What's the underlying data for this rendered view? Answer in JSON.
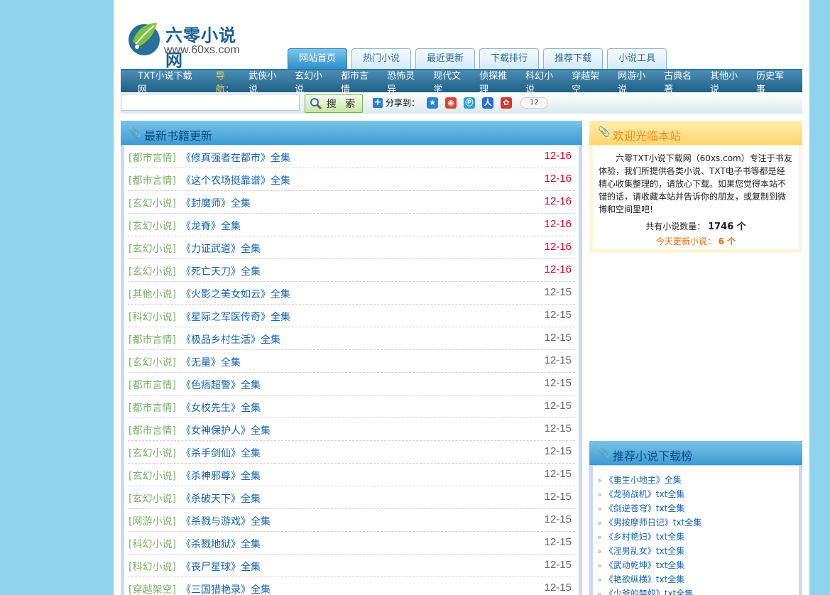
{
  "logo": {
    "cn": "六零小说网",
    "url": "www.60xs.com"
  },
  "tabs": [
    {
      "label": "网站首页",
      "active": true
    },
    {
      "label": "热门小说"
    },
    {
      "label": "最近更新"
    },
    {
      "label": "下载排行"
    },
    {
      "label": "推荐下载"
    },
    {
      "label": "小说工具"
    }
  ],
  "nav": {
    "brand": "TXT小说下载网",
    "label": "导航：",
    "items": [
      "武侠小说",
      "玄幻小说",
      "都市言情",
      "恐怖灵异",
      "现代文学",
      "侦探推理",
      "科幻小说",
      "穿越架空",
      "网游小说",
      "古典名著",
      "其他小说",
      "历史军事"
    ]
  },
  "search": {
    "button_label": "搜 索",
    "share_label": "分享到：",
    "share_count": "12"
  },
  "latest": {
    "title": "最新书籍更新",
    "rows": [
      {
        "cat": "[都市言情]",
        "title": "《修真强者在都市》全集",
        "date": "12-16",
        "today": true
      },
      {
        "cat": "[都市言情]",
        "title": "《这个农场挺靠谱》全集",
        "date": "12-16",
        "today": true
      },
      {
        "cat": "[玄幻小说]",
        "title": "《封魔师》全集",
        "date": "12-16",
        "today": true
      },
      {
        "cat": "[玄幻小说]",
        "title": "《龙脊》全集",
        "date": "12-16",
        "today": true
      },
      {
        "cat": "[玄幻小说]",
        "title": "《力证武道》全集",
        "date": "12-16",
        "today": true
      },
      {
        "cat": "[玄幻小说]",
        "title": "《死亡天刀》全集",
        "date": "12-16",
        "today": true
      },
      {
        "cat": "[其他小说]",
        "title": "《火影之美女如云》全集",
        "date": "12-15"
      },
      {
        "cat": "[科幻小说]",
        "title": "《星际之军医传奇》全集",
        "date": "12-15"
      },
      {
        "cat": "[都市言情]",
        "title": "《极品乡村生活》全集",
        "date": "12-15"
      },
      {
        "cat": "[玄幻小说]",
        "title": "《无量》全集",
        "date": "12-15"
      },
      {
        "cat": "[都市言情]",
        "title": "《色痞超警》全集",
        "date": "12-15"
      },
      {
        "cat": "[都市言情]",
        "title": "《女校先生》全集",
        "date": "12-15"
      },
      {
        "cat": "[都市言情]",
        "title": "《女神保护人》全集",
        "date": "12-15"
      },
      {
        "cat": "[玄幻小说]",
        "title": "《杀手剑仙》全集",
        "date": "12-15"
      },
      {
        "cat": "[玄幻小说]",
        "title": "《杀神邪尊》全集",
        "date": "12-15"
      },
      {
        "cat": "[玄幻小说]",
        "title": "《杀破天下》全集",
        "date": "12-15"
      },
      {
        "cat": "[网游小说]",
        "title": "《杀戮与游戏》全集",
        "date": "12-15"
      },
      {
        "cat": "[科幻小说]",
        "title": "《杀戮地狱》全集",
        "date": "12-15"
      },
      {
        "cat": "[科幻小说]",
        "title": "《丧尸星球》全集",
        "date": "12-15"
      },
      {
        "cat": "[穿越架空]",
        "title": "《三国猎艳录》全集",
        "date": "12-15"
      }
    ]
  },
  "welcome": {
    "title": "欢迎光临本站",
    "text": "六零TXT小说下载网（60xs.com）专注于书友体验，我们所提供各类小说、TXT电子书等都是经精心收集整理的，请放心下载。如果您觉得本站不错的话，请收藏本站并告诉你的朋友，或复制到微博和空间里吧!",
    "count_label": "共有小说数量：",
    "count_value": "1746 个",
    "today_label": "今天更新小说：",
    "today_value": "6 个"
  },
  "recommend": {
    "title": "推荐小说下载榜",
    "items": [
      "《重生小地主》全集",
      "《龙骑战机》txt全集",
      "《剑逆苍穹》txt全集",
      "《男按摩师日记》txt全集",
      "《乡村艳妇》txt全集",
      "《淫男乱女》txt全集",
      "《武动乾坤》txt全集",
      "《艳欲纵横》txt全集",
      "《少爷的禁奴》txt全集"
    ]
  }
}
